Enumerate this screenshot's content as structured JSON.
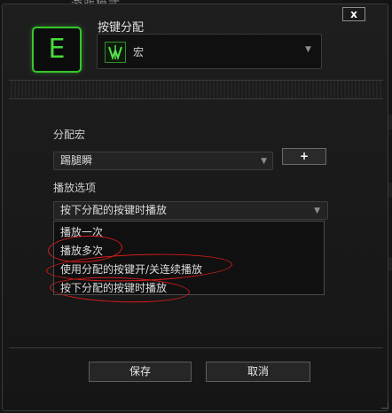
{
  "backdrop": {
    "title": "游戏模式"
  },
  "dialog": {
    "close_label": "x",
    "key_label": "E",
    "header_title": "按键分配",
    "assignment": {
      "value": "宏",
      "icon": "macro-icon"
    }
  },
  "macro_section": {
    "label": "分配宏",
    "selected": "踢腿瞬",
    "add_label": "+"
  },
  "playback_section": {
    "label": "播放选项",
    "selected": "按下分配的按键时播放",
    "options": [
      {
        "label": "播放一次",
        "circled": false
      },
      {
        "label": "播放多次",
        "circled": true
      },
      {
        "label": "使用分配的按键开/关连续播放",
        "circled": true
      },
      {
        "label": "按下分配的按键时播放",
        "circled": true
      }
    ]
  },
  "buttons": {
    "save": "保存",
    "cancel": "取消"
  },
  "colors": {
    "accent_green": "#37c62e",
    "annotation_red": "#d41c1c",
    "background": "#141414"
  }
}
